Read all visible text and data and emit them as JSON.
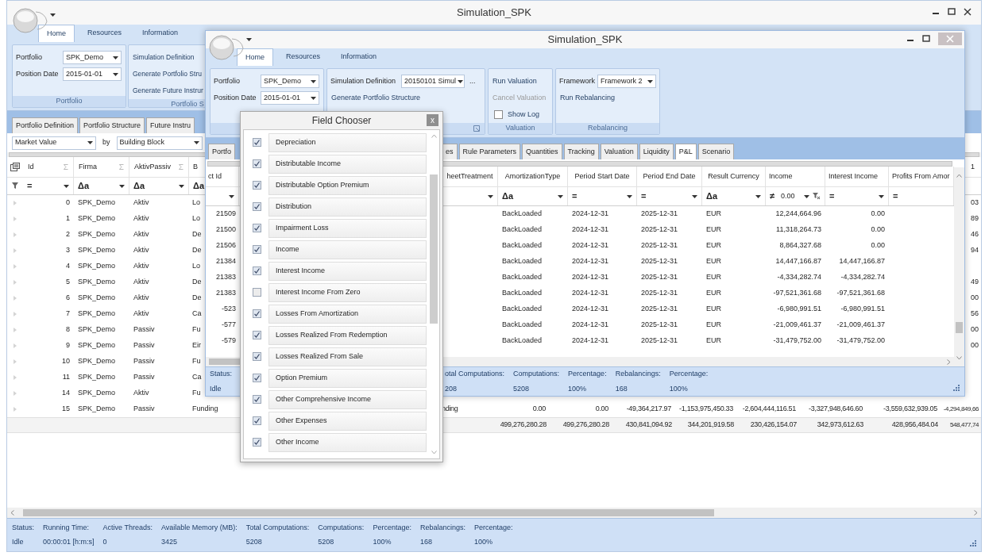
{
  "back_window": {
    "title": "Simulation_SPK",
    "ribbon_tabs": [
      {
        "label": "Home",
        "selected": true
      },
      {
        "label": "Resources",
        "selected": false
      },
      {
        "label": "Information",
        "selected": false
      }
    ],
    "ribbon_groups": [
      {
        "label": "Portfolio",
        "items": [
          {
            "kind": "combo",
            "label": "Portfolio",
            "value": "SPK_Demo"
          },
          {
            "kind": "combo",
            "label": "Position Date",
            "value": "2015-01-01"
          }
        ]
      },
      {
        "label": "Portfolio S",
        "items": [
          {
            "kind": "button",
            "label": "Simulation Definition",
            "disabled": false
          },
          {
            "kind": "button",
            "label": "Generate Portfolio Stru",
            "disabled": false
          },
          {
            "kind": "button",
            "label": "Generate Future Instrur",
            "disabled": false
          }
        ]
      }
    ],
    "view_tabs": [
      {
        "label": "Portfolio Definition",
        "selected": false
      },
      {
        "label": "Portfolio Structure",
        "selected": false
      },
      {
        "label": "Future Instru",
        "selected": false
      }
    ],
    "measure": "Market Value",
    "by_label": "by",
    "group_by": "Building Block",
    "grid": {
      "columns": [
        {
          "label": "Id",
          "filter_op": "="
        },
        {
          "label": "Firma",
          "filter_op": "Δa"
        },
        {
          "label": "AktivPassiv",
          "filter_op": "Δa"
        },
        {
          "label": "B",
          "filter_op": "Δa"
        }
      ],
      "edge_header": "1",
      "rows": [
        {
          "cells": [
            "0",
            "SPK_Demo",
            "Aktiv",
            "Lo"
          ],
          "edge": "03"
        },
        {
          "cells": [
            "1",
            "SPK_Demo",
            "Aktiv",
            "Lo"
          ],
          "edge": "89"
        },
        {
          "cells": [
            "2",
            "SPK_Demo",
            "Aktiv",
            "De"
          ],
          "edge": "46"
        },
        {
          "cells": [
            "3",
            "SPK_Demo",
            "Aktiv",
            "De"
          ],
          "edge": "94"
        },
        {
          "cells": [
            "4",
            "SPK_Demo",
            "Aktiv",
            "Lo"
          ]
        },
        {
          "cells": [
            "5",
            "SPK_Demo",
            "Aktiv",
            "De"
          ],
          "edge": "49"
        },
        {
          "cells": [
            "6",
            "SPK_Demo",
            "Aktiv",
            "De"
          ],
          "edge": "00"
        },
        {
          "cells": [
            "7",
            "SPK_Demo",
            "Aktiv",
            "Ca"
          ],
          "edge": "56"
        },
        {
          "cells": [
            "8",
            "SPK_Demo",
            "Passiv",
            "Fu"
          ],
          "edge": "00"
        },
        {
          "cells": [
            "9",
            "SPK_Demo",
            "Passiv",
            "Eir"
          ],
          "edge": "00"
        },
        {
          "cells": [
            "10",
            "SPK_Demo",
            "Passiv",
            "Fu"
          ]
        },
        {
          "cells": [
            "11",
            "SPK_Demo",
            "Passiv",
            "Ca"
          ]
        },
        {
          "cells": [
            "14",
            "SPK_Demo",
            "Aktiv",
            "Fu"
          ]
        },
        {
          "cells": [
            "15",
            "SPK_Demo",
            "Passiv",
            "Funding"
          ],
          "tail": [
            "nding",
            "0.00",
            "0.00",
            "-49,364,217.97",
            "-1,153,975,450.33",
            "-2,604,444,116.51",
            "-3,327,948,646.60",
            "-3,559,632,939.05",
            "-4,294,849,66"
          ]
        }
      ],
      "totals": [
        "499,276,280.28",
        "499,276,280.28",
        "430,841,094.92",
        "344,201,919.58",
        "230,426,154.07",
        "342,973,612.63",
        "428,956,484.04",
        "548,477,74"
      ]
    },
    "status_bar": [
      {
        "label": "Status:",
        "value": "Idle"
      },
      {
        "label": "Running Time:",
        "value": "00:00:01 [h:m:s]"
      },
      {
        "label": "Active Threads:",
        "value": "0"
      },
      {
        "label": "Available Memory (MB):",
        "value": "3425"
      },
      {
        "label": "Total Computations:",
        "value": "5208"
      },
      {
        "label": "Computations:",
        "value": "5208"
      },
      {
        "label": "Percentage:",
        "value": "100%"
      },
      {
        "label": "Rebalancings:",
        "value": "168"
      },
      {
        "label": "Percentage:",
        "value": "100%"
      }
    ]
  },
  "front_window": {
    "title": "Simulation_SPK",
    "ribbon_tabs": [
      {
        "label": "Home",
        "selected": true
      },
      {
        "label": "Resources",
        "selected": false
      },
      {
        "label": "Information",
        "selected": false
      }
    ],
    "ribbon_groups": [
      {
        "items": [
          {
            "kind": "combo",
            "label": "Portfolio",
            "value": "SPK_Demo"
          },
          {
            "kind": "combo",
            "label": "Position Date",
            "value": "2015-01-01"
          }
        ]
      },
      {
        "dialog_launcher": true,
        "items": [
          {
            "kind": "combo",
            "label": "Simulation Definition",
            "value": "20150101 Simul",
            "more": "..."
          },
          {
            "kind": "button",
            "label": "Generate Portfolio Structure",
            "disabled": false
          }
        ]
      },
      {
        "label": "Valuation",
        "items": [
          {
            "kind": "button",
            "label": "Run Valuation",
            "disabled": false
          },
          {
            "kind": "button",
            "label": "Cancel Valuation",
            "disabled": true
          },
          {
            "kind": "checkbox",
            "label": "Show Log",
            "checked": false
          }
        ]
      },
      {
        "label": "Rebalancing",
        "items": [
          {
            "kind": "combo",
            "label": "Framework",
            "value": "Framework 2"
          },
          {
            "kind": "button",
            "label": "Run Rebalancing",
            "disabled": false
          }
        ]
      }
    ],
    "view_tabs_left": [
      {
        "label": "Portfo",
        "selected": false
      }
    ],
    "view_tabs": [
      {
        "label": "es",
        "selected": false
      },
      {
        "label": "Rule Parameters",
        "selected": false
      },
      {
        "label": "Quantities",
        "selected": false
      },
      {
        "label": "Tracking",
        "selected": false
      },
      {
        "label": "Valuation",
        "selected": false
      },
      {
        "label": "Liquidity",
        "selected": false
      },
      {
        "label": "P&L",
        "selected": true
      },
      {
        "label": "Scenario",
        "selected": false
      }
    ],
    "grid": {
      "id_column": {
        "label": "ct Id",
        "dropdown": true
      },
      "columns": [
        {
          "label": "heetTreatment",
          "kind": "text",
          "dropdown": true
        },
        {
          "label": "AmortizationType",
          "kind": "text",
          "filter_op": "Δa",
          "dropdown": true
        },
        {
          "label": "Period Start Date",
          "kind": "text",
          "filter_op": "=",
          "dropdown": true
        },
        {
          "label": "Period End Date",
          "kind": "text",
          "filter_op": "=",
          "dropdown": true
        },
        {
          "label": "Result Currency",
          "kind": "text",
          "filter_op": "Δa",
          "dropdown": true
        },
        {
          "label": "Income",
          "kind": "number",
          "filter_op": "≠",
          "filter_value": "0.00",
          "dropdown": true,
          "clear_filter": true
        },
        {
          "label": "Interest Income",
          "kind": "number",
          "filter_op": "=",
          "dropdown": true
        },
        {
          "label": "Profits From Amor",
          "kind": "number",
          "filter_op": "="
        }
      ],
      "rows": [
        {
          "id": "21509",
          "cells": [
            "",
            "BackLoaded",
            "2024-12-31",
            "2025-12-31",
            "EUR",
            "12,244,664.96",
            "0.00"
          ]
        },
        {
          "id": "21500",
          "cells": [
            "",
            "BackLoaded",
            "2024-12-31",
            "2025-12-31",
            "EUR",
            "11,318,264.73",
            "0.00"
          ]
        },
        {
          "id": "21506",
          "cells": [
            "",
            "BackLoaded",
            "2024-12-31",
            "2025-12-31",
            "EUR",
            "8,864,327.68",
            "0.00"
          ]
        },
        {
          "id": "21384",
          "cells": [
            "",
            "BackLoaded",
            "2024-12-31",
            "2025-12-31",
            "EUR",
            "14,447,166.87",
            "14,447,166.87"
          ]
        },
        {
          "id": "21383",
          "cells": [
            "",
            "BackLoaded",
            "2024-12-31",
            "2025-12-31",
            "EUR",
            "-4,334,282.74",
            "-4,334,282.74"
          ]
        },
        {
          "id": "21383",
          "cells": [
            "",
            "BackLoaded",
            "2024-12-31",
            "2025-12-31",
            "EUR",
            "-97,521,361.68",
            "-97,521,361.68"
          ]
        },
        {
          "id": "-523",
          "cells": [
            "",
            "BackLoaded",
            "2024-12-31",
            "2025-12-31",
            "EUR",
            "-6,980,991.51",
            "-6,980,991.51"
          ]
        },
        {
          "id": "-577",
          "cells": [
            "",
            "BackLoaded",
            "2024-12-31",
            "2025-12-31",
            "EUR",
            "-21,009,461.37",
            "-21,009,461.37"
          ]
        },
        {
          "id": "-579",
          "cells": [
            "",
            "BackLoaded",
            "2024-12-31",
            "2025-12-31",
            "EUR",
            "-31,479,752.00",
            "-31,479,752.00"
          ]
        }
      ]
    },
    "status_left": [
      {
        "label": "Status:",
        "value": "Idle"
      }
    ],
    "status_right": [
      {
        "label": "otal Computations:",
        "value": "208"
      },
      {
        "label": "Computations:",
        "value": "5208"
      },
      {
        "label": "Percentage:",
        "value": "100%"
      },
      {
        "label": "Rebalancings:",
        "value": "168"
      },
      {
        "label": "Percentage:",
        "value": "100%"
      }
    ]
  },
  "field_chooser": {
    "title": "Field Chooser",
    "close": "x",
    "items": [
      {
        "label": "Depreciation",
        "checked": true
      },
      {
        "label": "Distributable Income",
        "checked": true
      },
      {
        "label": "Distributable Option Premium",
        "checked": true
      },
      {
        "label": "Distribution",
        "checked": true
      },
      {
        "label": "Impairment Loss",
        "checked": true
      },
      {
        "label": "Income",
        "checked": true
      },
      {
        "label": "Interest Income",
        "checked": true
      },
      {
        "label": "Interest Income From Zero",
        "checked": false
      },
      {
        "label": "Losses From Amortization",
        "checked": true
      },
      {
        "label": "Losses Realized From Redemption",
        "checked": true
      },
      {
        "label": "Losses Realized From Sale",
        "checked": true
      },
      {
        "label": "Option Premium",
        "checked": true
      },
      {
        "label": "Other Comprehensive Income",
        "checked": true
      },
      {
        "label": "Other Expenses",
        "checked": true
      },
      {
        "label": "Other Income",
        "checked": true
      }
    ]
  }
}
